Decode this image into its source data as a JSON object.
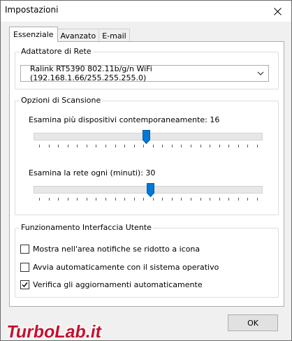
{
  "window": {
    "title": "Impostazioni"
  },
  "tabs": [
    {
      "label": "Essenziale",
      "active": true
    },
    {
      "label": "Avanzato",
      "active": false
    },
    {
      "label": "E-mail",
      "active": false
    }
  ],
  "adapter_group": {
    "legend": "Adattatore di Rete",
    "selected": "Ralink RT5390 802.11b/g/n WiFi (192.168.1.66/255.255.255.0)"
  },
  "scan_group": {
    "legend": "Opzioni di Scansione",
    "devices_label": "Esamina più dispositivi contemporaneamente: 16",
    "devices_slider_fraction": 0.49,
    "interval_label": "Esamina la rete ogni (minuti): 30",
    "interval_slider_fraction": 0.51
  },
  "ui_group": {
    "legend": "Funzionamento Interfaccia Utente",
    "options": [
      {
        "label": "Mostra nell'area notifiche se ridotto a icona",
        "checked": false
      },
      {
        "label": "Avvia automaticamente con il sistema operativo",
        "checked": false
      },
      {
        "label": "Verifica gli aggiornamenti automaticamente",
        "checked": true
      }
    ]
  },
  "buttons": {
    "ok": "OK"
  },
  "watermark": {
    "text": "TurboLab.it",
    "color": "#c8102e"
  }
}
